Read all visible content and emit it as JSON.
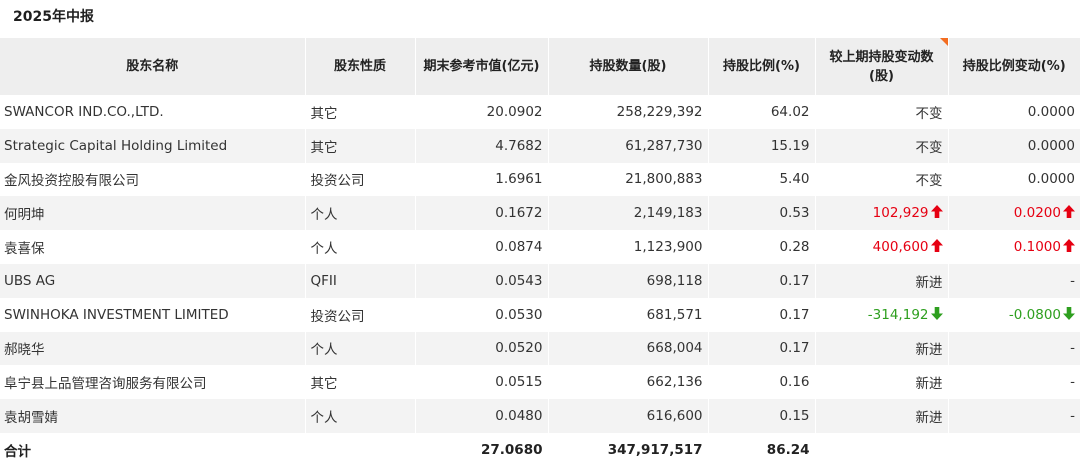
{
  "section_title": "2025年中报",
  "headers": [
    "股东名称",
    "股东性质",
    "期末参考市值(亿元)",
    "持股数量(股)",
    "持股比例(%)",
    "较上期持股变动数(股)",
    "持股比例变动(%)"
  ],
  "colors": {
    "up": "#e60012",
    "down": "#2e9f1f",
    "header_bg": "#eeeeee",
    "stripe_bg": "#f3f3f3",
    "corner_flag": "#f36d21"
  },
  "rows": [
    {
      "name": "SWANCOR IND.CO.,LTD.",
      "type": "其它",
      "market_value": "20.0902",
      "shares": "258,229,392",
      "ratio": "64.02",
      "change_shares": "不变",
      "change_shares_dir": "none",
      "change_ratio": "0.0000",
      "change_ratio_dir": "none"
    },
    {
      "name": "Strategic Capital Holding Limited",
      "type": "其它",
      "market_value": "4.7682",
      "shares": "61,287,730",
      "ratio": "15.19",
      "change_shares": "不变",
      "change_shares_dir": "none",
      "change_ratio": "0.0000",
      "change_ratio_dir": "none"
    },
    {
      "name": "金风投资控股有限公司",
      "type": "投资公司",
      "market_value": "1.6961",
      "shares": "21,800,883",
      "ratio": "5.40",
      "change_shares": "不变",
      "change_shares_dir": "none",
      "change_ratio": "0.0000",
      "change_ratio_dir": "none"
    },
    {
      "name": "何明坤",
      "type": "个人",
      "market_value": "0.1672",
      "shares": "2,149,183",
      "ratio": "0.53",
      "change_shares": "102,929",
      "change_shares_dir": "up",
      "change_ratio": "0.0200",
      "change_ratio_dir": "up"
    },
    {
      "name": "袁喜保",
      "type": "个人",
      "market_value": "0.0874",
      "shares": "1,123,900",
      "ratio": "0.28",
      "change_shares": "400,600",
      "change_shares_dir": "up",
      "change_ratio": "0.1000",
      "change_ratio_dir": "up"
    },
    {
      "name": "UBS AG",
      "type": "QFII",
      "market_value": "0.0543",
      "shares": "698,118",
      "ratio": "0.17",
      "change_shares": "新进",
      "change_shares_dir": "none",
      "change_ratio": "-",
      "change_ratio_dir": "none"
    },
    {
      "name": "SWINHOKA INVESTMENT LIMITED",
      "type": "投资公司",
      "market_value": "0.0530",
      "shares": "681,571",
      "ratio": "0.17",
      "change_shares": "-314,192",
      "change_shares_dir": "down",
      "change_ratio": "-0.0800",
      "change_ratio_dir": "down"
    },
    {
      "name": "郝晓华",
      "type": "个人",
      "market_value": "0.0520",
      "shares": "668,004",
      "ratio": "0.17",
      "change_shares": "新进",
      "change_shares_dir": "none",
      "change_ratio": "-",
      "change_ratio_dir": "none"
    },
    {
      "name": "阜宁县上品管理咨询服务有限公司",
      "type": "其它",
      "market_value": "0.0515",
      "shares": "662,136",
      "ratio": "0.16",
      "change_shares": "新进",
      "change_shares_dir": "none",
      "change_ratio": "-",
      "change_ratio_dir": "none"
    },
    {
      "name": "袁胡雪婧",
      "type": "个人",
      "market_value": "0.0480",
      "shares": "616,600",
      "ratio": "0.15",
      "change_shares": "新进",
      "change_shares_dir": "none",
      "change_ratio": "-",
      "change_ratio_dir": "none"
    }
  ],
  "total": {
    "label": "合计",
    "type": "",
    "market_value": "27.0680",
    "shares": "347,917,517",
    "ratio": "86.24",
    "change_shares": "",
    "change_ratio": ""
  }
}
